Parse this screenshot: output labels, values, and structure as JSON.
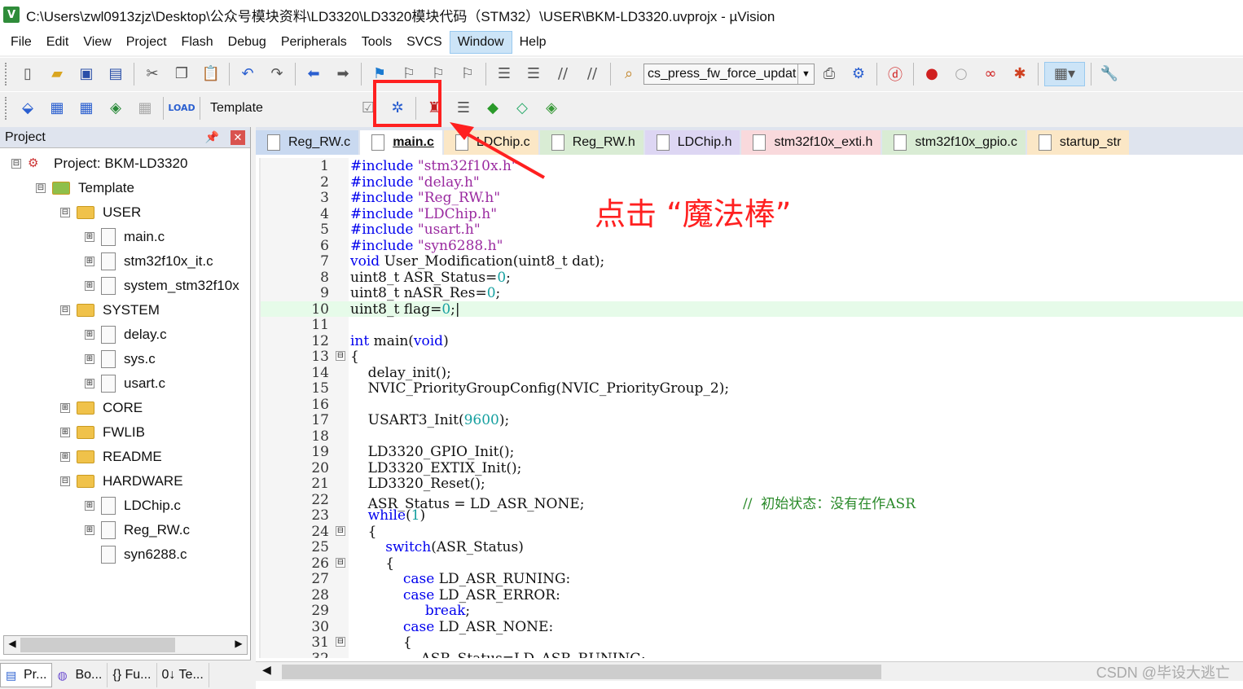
{
  "window": {
    "title": "C:\\Users\\zwl0913zjz\\Desktop\\公众号模块资料\\LD3320\\LD3320模块代码（STM32）\\USER\\BKM-LD3320.uvprojx - µVision",
    "app_logo": "V"
  },
  "menu": [
    "File",
    "Edit",
    "View",
    "Project",
    "Flash",
    "Debug",
    "Peripherals",
    "Tools",
    "SVCS",
    "Window",
    "Help"
  ],
  "toolbar1": {
    "combo_value": "cs_press_fw_force_updat"
  },
  "toolbar2": {
    "target": "Template"
  },
  "project_panel": {
    "header": "Project",
    "tree": [
      {
        "label": "Project: BKM-LD3320",
        "type": "project",
        "expander": "⊟"
      },
      {
        "label": "Template",
        "type": "target",
        "expander": "⊟"
      },
      {
        "label": "USER",
        "type": "folder",
        "expander": "⊟"
      },
      {
        "label": "main.c",
        "type": "file",
        "expander": "⊞"
      },
      {
        "label": "stm32f10x_it.c",
        "type": "file",
        "expander": "⊞"
      },
      {
        "label": "system_stm32f10x",
        "type": "file",
        "expander": "⊞"
      },
      {
        "label": "SYSTEM",
        "type": "folder",
        "expander": "⊟"
      },
      {
        "label": "delay.c",
        "type": "file",
        "expander": "⊞"
      },
      {
        "label": "sys.c",
        "type": "file",
        "expander": "⊞"
      },
      {
        "label": "usart.c",
        "type": "file",
        "expander": "⊞"
      },
      {
        "label": "CORE",
        "type": "folder",
        "expander": "⊞"
      },
      {
        "label": "FWLIB",
        "type": "folder",
        "expander": "⊞"
      },
      {
        "label": "README",
        "type": "folder",
        "expander": "⊞"
      },
      {
        "label": "HARDWARE",
        "type": "folder",
        "expander": "⊟"
      },
      {
        "label": "LDChip.c",
        "type": "file",
        "expander": "⊞"
      },
      {
        "label": "Reg_RW.c",
        "type": "file",
        "expander": "⊞"
      },
      {
        "label": "syn6288.c",
        "type": "file",
        "expander": ""
      }
    ],
    "bottom_tabs": [
      "Pr...",
      "Bo...",
      "{} Fu...",
      "0↓ Te..."
    ]
  },
  "editor": {
    "tabs": [
      {
        "label": "Reg_RW.c",
        "active": false
      },
      {
        "label": "main.c",
        "active": true
      },
      {
        "label": "LDChip.c",
        "active": false
      },
      {
        "label": "Reg_RW.h",
        "active": false
      },
      {
        "label": "LDChip.h",
        "active": false
      },
      {
        "label": "stm32f10x_exti.h",
        "active": false
      },
      {
        "label": "stm32f10x_gpio.c",
        "active": false
      },
      {
        "label": "startup_str",
        "active": false
      }
    ],
    "lines": [
      {
        "n": "1",
        "code": [
          [
            "pre",
            "#include "
          ],
          [
            "str",
            "\"stm32f10x.h\""
          ]
        ]
      },
      {
        "n": "2",
        "code": [
          [
            "pre",
            "#include "
          ],
          [
            "str",
            "\"delay.h\""
          ]
        ]
      },
      {
        "n": "3",
        "code": [
          [
            "pre",
            "#include "
          ],
          [
            "str",
            "\"Reg_RW.h\""
          ]
        ]
      },
      {
        "n": "4",
        "code": [
          [
            "pre",
            "#include "
          ],
          [
            "str",
            "\"LDChip.h\""
          ]
        ]
      },
      {
        "n": "5",
        "code": [
          [
            "pre",
            "#include "
          ],
          [
            "str",
            "\"usart.h\""
          ]
        ]
      },
      {
        "n": "6",
        "code": [
          [
            "pre",
            "#include "
          ],
          [
            "str",
            "\"syn6288.h\""
          ]
        ]
      },
      {
        "n": "7",
        "code": [
          [
            "kw",
            "void"
          ],
          [
            "t",
            " User_Modification(uint8_t dat);"
          ]
        ]
      },
      {
        "n": "8",
        "code": [
          [
            "t",
            "uint8_t ASR_Status="
          ],
          [
            "num",
            "0"
          ],
          [
            "t",
            ";"
          ]
        ]
      },
      {
        "n": "9",
        "code": [
          [
            "t",
            "uint8_t nASR_Res="
          ],
          [
            "num",
            "0"
          ],
          [
            "t",
            ";"
          ]
        ]
      },
      {
        "n": "10",
        "code": [
          [
            "t",
            "uint8_t flag="
          ],
          [
            "num",
            "0"
          ],
          [
            "t",
            ";|"
          ]
        ],
        "current": true
      },
      {
        "n": "11",
        "code": []
      },
      {
        "n": "12",
        "code": [
          [
            "kw",
            "int"
          ],
          [
            "t",
            " main("
          ],
          [
            "kw",
            "void"
          ],
          [
            "t",
            ")"
          ]
        ]
      },
      {
        "n": "13",
        "code": [
          [
            "t",
            "{"
          ]
        ],
        "fold": "⊟"
      },
      {
        "n": "14",
        "code": [
          [
            "t",
            "    delay_init();"
          ]
        ]
      },
      {
        "n": "15",
        "code": [
          [
            "t",
            "    NVIC_PriorityGroupConfig(NVIC_PriorityGroup_2);"
          ]
        ]
      },
      {
        "n": "16",
        "code": []
      },
      {
        "n": "17",
        "code": [
          [
            "t",
            "    USART3_Init("
          ],
          [
            "num",
            "9600"
          ],
          [
            "t",
            ");"
          ]
        ]
      },
      {
        "n": "18",
        "code": []
      },
      {
        "n": "19",
        "code": [
          [
            "t",
            "    LD3320_GPIO_Init();"
          ]
        ]
      },
      {
        "n": "20",
        "code": [
          [
            "t",
            "    LD3320_EXTIX_Init();"
          ]
        ]
      },
      {
        "n": "21",
        "code": [
          [
            "t",
            "    LD3320_Reset();"
          ]
        ]
      },
      {
        "n": "22",
        "code": [
          [
            "t",
            "    ASR_Status = LD_ASR_NONE;                                    "
          ],
          [
            "cm",
            "//  初始状态：没有在作ASR"
          ]
        ]
      },
      {
        "n": "23",
        "code": [
          [
            "t",
            "    "
          ],
          [
            "kw",
            "while"
          ],
          [
            "t",
            "("
          ],
          [
            "num",
            "1"
          ],
          [
            "t",
            ")"
          ]
        ]
      },
      {
        "n": "24",
        "code": [
          [
            "t",
            "    {"
          ]
        ],
        "fold": "⊟"
      },
      {
        "n": "25",
        "code": [
          [
            "t",
            "        "
          ],
          [
            "kw",
            "switch"
          ],
          [
            "t",
            "(ASR_Status)"
          ]
        ]
      },
      {
        "n": "26",
        "code": [
          [
            "t",
            "        {"
          ]
        ],
        "fold": "⊟"
      },
      {
        "n": "27",
        "code": [
          [
            "t",
            "            "
          ],
          [
            "kw",
            "case"
          ],
          [
            "t",
            " LD_ASR_RUNING:"
          ]
        ]
      },
      {
        "n": "28",
        "code": [
          [
            "t",
            "            "
          ],
          [
            "kw",
            "case"
          ],
          [
            "t",
            " LD_ASR_ERROR:"
          ]
        ]
      },
      {
        "n": "29",
        "code": [
          [
            "t",
            "                 "
          ],
          [
            "kw",
            "break"
          ],
          [
            "t",
            ";"
          ]
        ]
      },
      {
        "n": "30",
        "code": [
          [
            "t",
            "            "
          ],
          [
            "kw",
            "case"
          ],
          [
            "t",
            " LD_ASR_NONE:"
          ]
        ]
      },
      {
        "n": "31",
        "code": [
          [
            "t",
            "            {"
          ]
        ],
        "fold": "⊟"
      },
      {
        "n": "32",
        "code": [
          [
            "t",
            "                ASR_Status=LD_ASR_RUNING;"
          ]
        ]
      }
    ]
  },
  "annotation": {
    "text": "点击 “魔法棒”",
    "color": "#ff2020"
  },
  "watermark": "CSDN @毕设大逃亡"
}
